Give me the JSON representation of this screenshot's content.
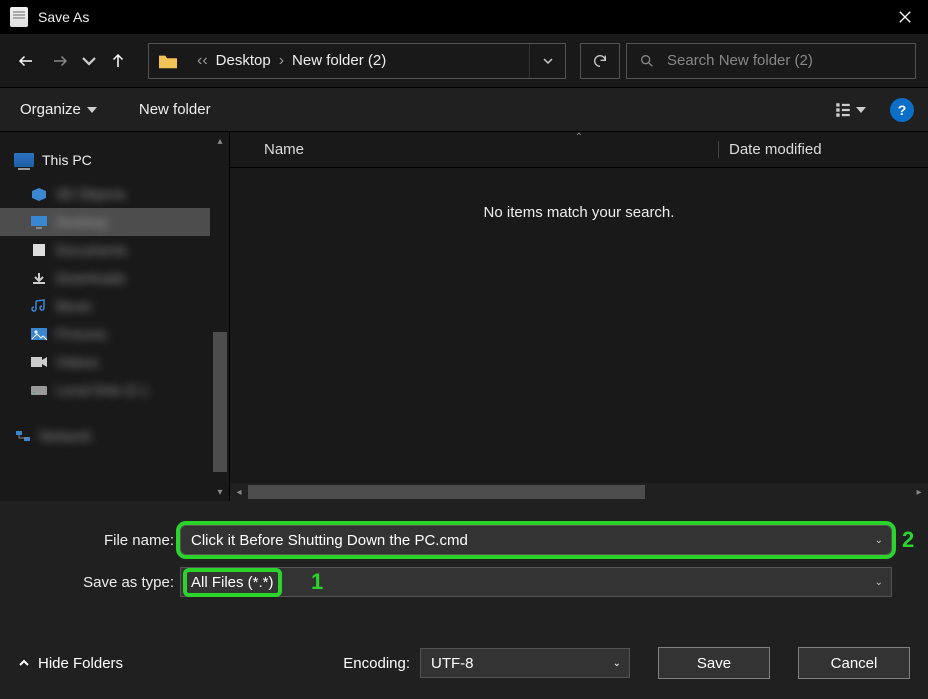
{
  "titlebar": {
    "title": "Save As"
  },
  "breadcrumb": {
    "items": [
      "Desktop",
      "New folder (2)"
    ]
  },
  "search": {
    "placeholder": "Search New folder (2)"
  },
  "toolbar": {
    "organize": "Organize",
    "newfolder": "New folder",
    "help": "?"
  },
  "tree": {
    "root": "This PC",
    "items": [
      "3D Objects",
      "Desktop",
      "Documents",
      "Downloads",
      "Music",
      "Pictures",
      "Videos",
      "Local Disk (C:)",
      "Network"
    ]
  },
  "columns": {
    "name": "Name",
    "date": "Date modified"
  },
  "content": {
    "empty": "No items match your search."
  },
  "filename": {
    "label": "File name:",
    "value": "Click it Before Shutting Down the PC.cmd"
  },
  "saveastype": {
    "label": "Save as type:",
    "value": "All Files  (*.*)"
  },
  "annotations": {
    "one": "1",
    "two": "2"
  },
  "footer": {
    "hidefolders": "Hide Folders",
    "encoding_label": "Encoding:",
    "encoding_value": "UTF-8",
    "save": "Save",
    "cancel": "Cancel"
  }
}
